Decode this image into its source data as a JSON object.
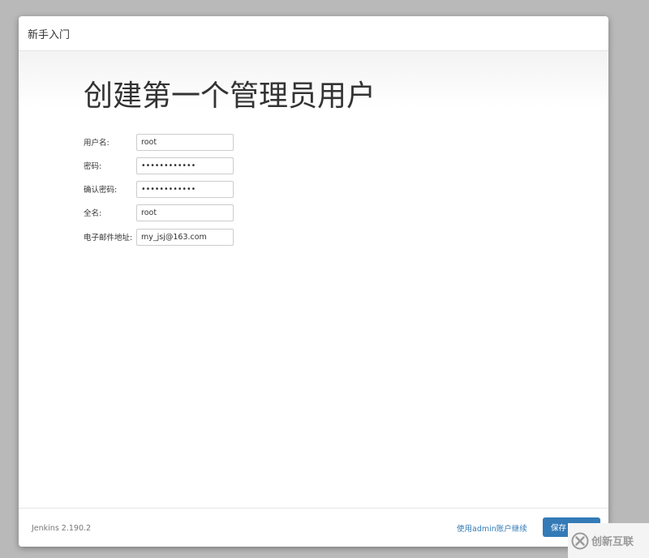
{
  "dialog": {
    "header_title": "新手入门",
    "page_title": "创建第一个管理员用户"
  },
  "form": {
    "fields": [
      {
        "label": "用户名:",
        "value": "root",
        "type": "text"
      },
      {
        "label": "密码:",
        "value": "••••••••••••",
        "type": "password"
      },
      {
        "label": "确认密码:",
        "value": "••••••••••••",
        "type": "password"
      },
      {
        "label": "全名:",
        "value": "root",
        "type": "text"
      },
      {
        "label": "电子邮件地址:",
        "value": "my_jsj@163.com",
        "type": "text"
      }
    ]
  },
  "footer": {
    "version": "Jenkins 2.190.2",
    "continue_link": "使用admin账户继续",
    "save_button": "保存"
  },
  "watermark": {
    "text": "创新互联",
    "logo_icon": "x-circle-logo-icon"
  },
  "colors": {
    "accent": "#337ab7",
    "background": "#b9b9b9"
  }
}
